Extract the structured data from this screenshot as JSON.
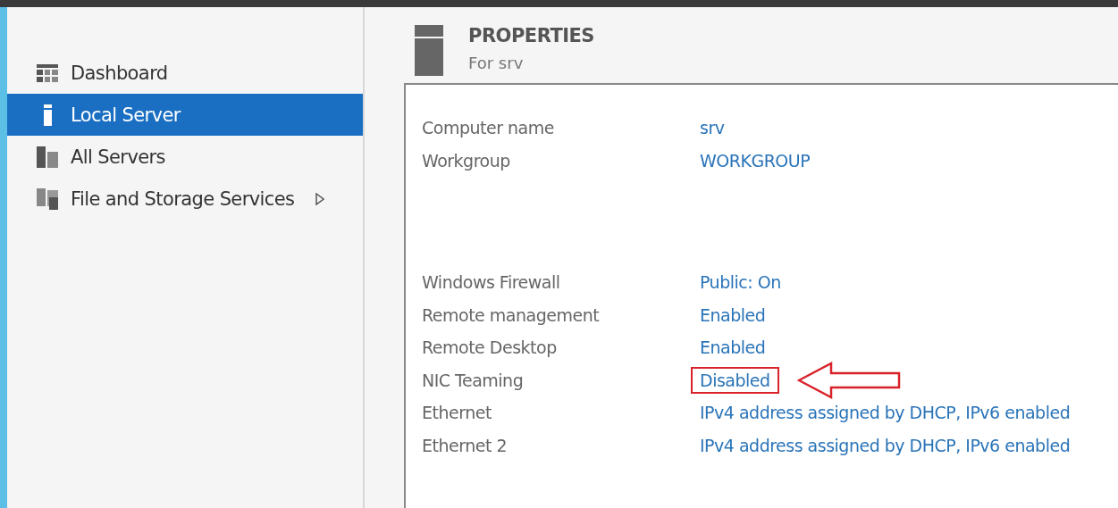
{
  "sidebar": {
    "items": [
      {
        "label": "Dashboard",
        "kind": "dashboard",
        "selected": false,
        "has_submenu": false
      },
      {
        "label": "Local Server",
        "kind": "server",
        "selected": true,
        "has_submenu": false
      },
      {
        "label": "All Servers",
        "kind": "servers",
        "selected": false,
        "has_submenu": false
      },
      {
        "label": "File and Storage Services",
        "kind": "storage",
        "selected": false,
        "has_submenu": true
      }
    ]
  },
  "properties": {
    "title": "PROPERTIES",
    "subtitle": "For srv",
    "groups": [
      [
        {
          "label": "Computer name",
          "value": "srv",
          "highlighted": false
        },
        {
          "label": "Workgroup",
          "value": "WORKGROUP",
          "highlighted": false
        }
      ],
      [
        {
          "label": "Windows Firewall",
          "value": "Public: On",
          "highlighted": false
        },
        {
          "label": "Remote management",
          "value": "Enabled",
          "highlighted": false
        },
        {
          "label": "Remote Desktop",
          "value": "Enabled",
          "highlighted": false
        },
        {
          "label": "NIC Teaming",
          "value": "Disabled",
          "highlighted": true
        },
        {
          "label": "Ethernet",
          "value": "IPv4 address assigned by DHCP, IPv6 enabled",
          "highlighted": false
        },
        {
          "label": "Ethernet 2",
          "value": "IPv4 address assigned by DHCP, IPv6 enabled",
          "highlighted": false
        }
      ]
    ]
  }
}
